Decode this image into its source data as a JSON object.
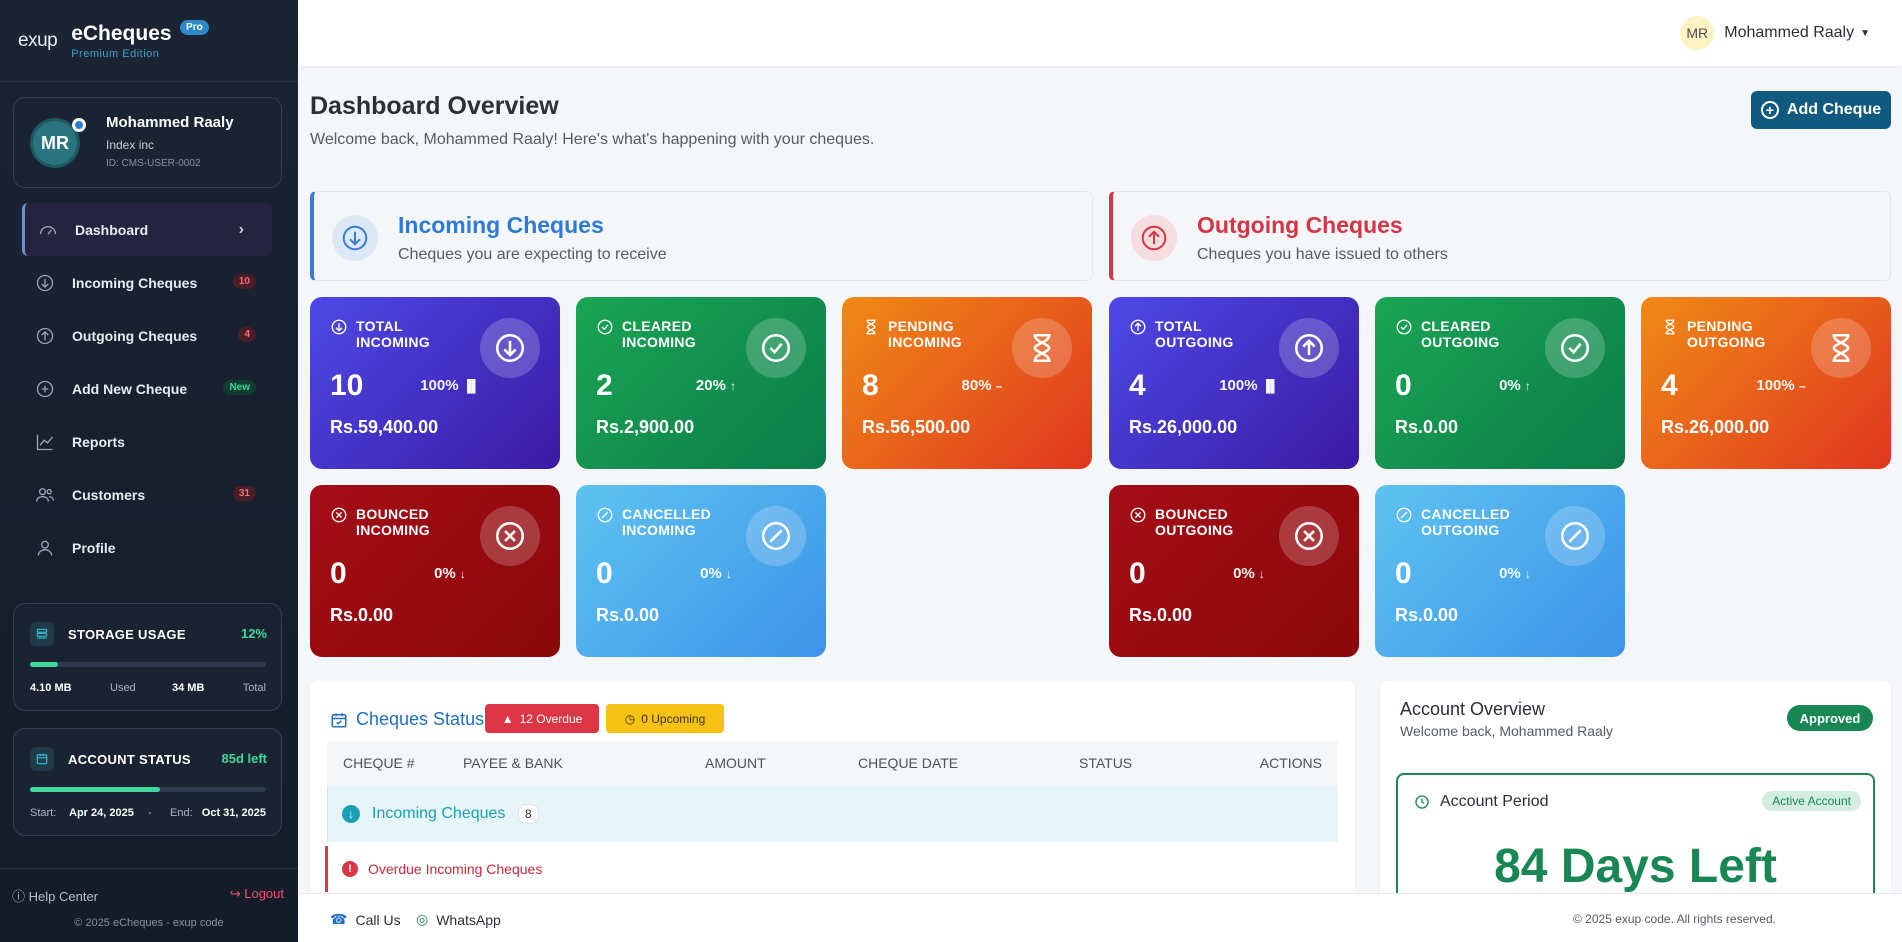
{
  "brand": {
    "logo": "exup",
    "name": "eCheques",
    "badge": "Pro",
    "edition": "Premium Edition"
  },
  "user_card": {
    "initials": "MR",
    "name": "Mohammed Raaly",
    "company": "Index inc",
    "id": "ID: CMS-USER-0002"
  },
  "nav": {
    "dashboard": "Dashboard",
    "incoming": "Incoming Cheques",
    "incoming_badge": "10",
    "outgoing": "Outgoing Cheques",
    "outgoing_badge": "4",
    "add": "Add New Cheque",
    "add_badge": "New",
    "reports": "Reports",
    "customers": "Customers",
    "customers_badge": "31",
    "profile": "Profile"
  },
  "storage": {
    "title": "STORAGE USAGE",
    "percent_text": "12%",
    "progress": 0.12,
    "used": "4.10 MB",
    "used_label": "Used",
    "total": "34 MB",
    "total_label": "Total"
  },
  "account_status": {
    "title": "ACCOUNT STATUS",
    "left_text": "85d left",
    "progress": 0.55,
    "start_label": "Start:",
    "start": "Apr 24, 2025",
    "sep": "-",
    "end_label": "End:",
    "end": "Oct 31, 2025"
  },
  "sidebar_footer": {
    "help": "Help Center",
    "logout": "Logout",
    "copyright": "© 2025 eCheques - exup code"
  },
  "topbar": {
    "initials": "MR",
    "user_name": "Mohammed Raaly"
  },
  "page": {
    "title": "Dashboard Overview",
    "subtitle": "Welcome back, Mohammed Raaly! Here's what's happening with your cheques.",
    "add_button": "Add Cheque"
  },
  "incoming_section": {
    "title": "Incoming Cheques",
    "subtitle": "Cheques you are expecting to receive"
  },
  "outgoing_section": {
    "title": "Outgoing Cheques",
    "subtitle": "Cheques you have issued to others"
  },
  "cards": {
    "total_in": {
      "l1": "TOTAL",
      "l2": "INCOMING",
      "count": "10",
      "pct": "100%",
      "amount": "Rs.59,400.00"
    },
    "cleared_in": {
      "l1": "CLEARED",
      "l2": "INCOMING",
      "count": "2",
      "pct": "20%",
      "amount": "Rs.2,900.00"
    },
    "pending_in": {
      "l1": "PENDING",
      "l2": "INCOMING",
      "count": "8",
      "pct": "80%",
      "amount": "Rs.56,500.00"
    },
    "bounced_in": {
      "l1": "BOUNCED",
      "l2": "INCOMING",
      "count": "0",
      "pct": "0%",
      "amount": "Rs.0.00"
    },
    "cancelled_in": {
      "l1": "CANCELLED",
      "l2": "INCOMING",
      "count": "0",
      "pct": "0%",
      "amount": "Rs.0.00"
    },
    "total_out": {
      "l1": "TOTAL",
      "l2": "OUTGOING",
      "count": "4",
      "pct": "100%",
      "amount": "Rs.26,000.00"
    },
    "cleared_out": {
      "l1": "CLEARED",
      "l2": "OUTGOING",
      "count": "0",
      "pct": "0%",
      "amount": "Rs.0.00"
    },
    "pending_out": {
      "l1": "PENDING",
      "l2": "OUTGOING",
      "count": "4",
      "pct": "100%",
      "amount": "Rs.26,000.00"
    },
    "bounced_out": {
      "l1": "BOUNCED",
      "l2": "OUTGOING",
      "count": "0",
      "pct": "0%",
      "amount": "Rs.0.00"
    },
    "cancelled_out": {
      "l1": "CANCELLED",
      "l2": "OUTGOING",
      "count": "0",
      "pct": "0%",
      "amount": "Rs.0.00"
    }
  },
  "status_table": {
    "title": "Cheques Status",
    "overdue_pill": "12 Overdue",
    "upcoming_pill": "0 Upcoming",
    "columns": [
      "CHEQUE #",
      "PAYEE & BANK",
      "AMOUNT",
      "CHEQUE DATE",
      "STATUS",
      "ACTIONS"
    ],
    "group_label": "Incoming Cheques",
    "group_count": "8",
    "overdue_label": "Overdue Incoming Cheques"
  },
  "account_overview": {
    "title": "Account Overview",
    "subtitle": "Welcome back, Mohammed Raaly",
    "status": "Approved",
    "period_title": "Account Period",
    "period_badge": "Active Account",
    "days_left": "84 Days Left"
  },
  "footer": {
    "call": "Call Us",
    "whatsapp": "WhatsApp",
    "copyright": "© 2025 exup code. All rights reserved."
  },
  "colors": {
    "incoming": "#2e7bd6",
    "outgoing": "#d63545",
    "success": "#198754",
    "sidebar": "#1b2433"
  }
}
